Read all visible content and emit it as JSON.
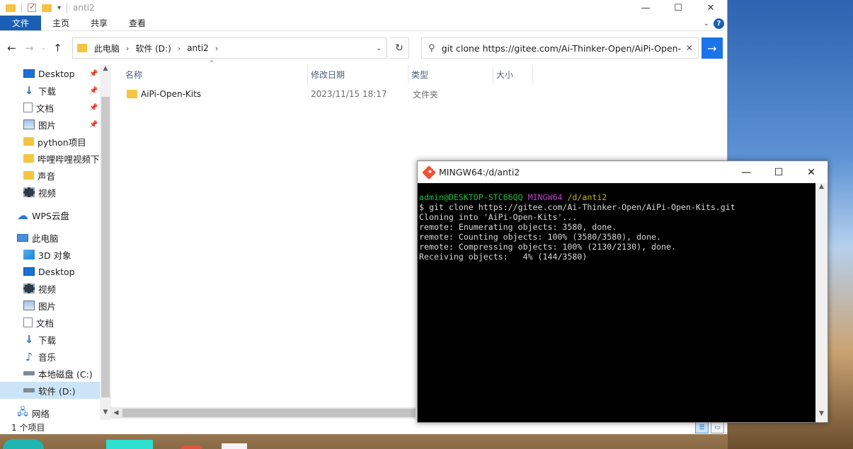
{
  "window": {
    "title": "anti2",
    "controls": [
      "—",
      "☐",
      "✕"
    ]
  },
  "ribbon": {
    "file_tab": "文件",
    "tabs": [
      "主页",
      "共享",
      "查看"
    ]
  },
  "address": {
    "crumbs": [
      "此电脑",
      "软件 (D:)",
      "anti2"
    ]
  },
  "search": {
    "value": "git clone https://gitee.com/Ai-Thinker-Open/AiPi-Open-Kits.git"
  },
  "nav": {
    "items": [
      {
        "label": "Desktop",
        "icon": "desktop-icon",
        "pinned": true
      },
      {
        "label": "下载",
        "icon": "download-icon",
        "pinned": true
      },
      {
        "label": "文档",
        "icon": "document-icon",
        "pinned": true
      },
      {
        "label": "图片",
        "icon": "picture-icon",
        "pinned": true
      },
      {
        "label": "python项目",
        "icon": "folder-icon"
      },
      {
        "label": "哔哩哔哩视频下载",
        "icon": "folder-icon"
      },
      {
        "label": "声音",
        "icon": "folder-icon"
      },
      {
        "label": "视频",
        "icon": "video-icon"
      }
    ],
    "wps": "WPS云盘",
    "pc": "此电脑",
    "pc_items": [
      {
        "label": "3D 对象",
        "icon": "3d-objects-icon"
      },
      {
        "label": "Desktop",
        "icon": "desktop-icon"
      },
      {
        "label": "视频",
        "icon": "video-icon"
      },
      {
        "label": "图片",
        "icon": "picture-icon"
      },
      {
        "label": "文档",
        "icon": "document-icon"
      },
      {
        "label": "下载",
        "icon": "download-icon"
      },
      {
        "label": "音乐",
        "icon": "music-icon"
      },
      {
        "label": "本地磁盘 (C:)",
        "icon": "drive-icon"
      },
      {
        "label": "软件 (D:)",
        "icon": "drive-icon",
        "selected": true
      }
    ],
    "network": "网络"
  },
  "files": {
    "columns": {
      "name": "名称",
      "modified": "修改日期",
      "type": "类型",
      "size": "大小"
    },
    "rows": [
      {
        "name": "AiPi-Open-Kits",
        "modified": "2023/11/15 18:17",
        "type": "文件夹"
      }
    ]
  },
  "status": {
    "count": "1 个项目"
  },
  "terminal": {
    "title": "MINGW64:/d/anti2",
    "prompt_user": "admin@DESKTOP-STC66QQ",
    "prompt_env": "MINGW64",
    "prompt_path": "/d/anti2",
    "lines": [
      "$ git clone https://gitee.com/Ai-Thinker-Open/AiPi-Open-Kits.git",
      "Cloning into 'AiPi-Open-Kits'...",
      "remote: Enumerating objects: 3580, done.",
      "remote: Counting objects: 100% (3580/3580), done.",
      "remote: Compressing objects: 100% (2130/2130), done.",
      "Receiving objects:   4% (144/3580)"
    ]
  },
  "colors": {
    "accent": "#1a5fb4",
    "selection": "#cce4f7",
    "terminal_bg": "#000000",
    "prompt_green": "#1fbf3f",
    "prompt_magenta": "#c13fc9",
    "prompt_yellow": "#c7b422"
  }
}
